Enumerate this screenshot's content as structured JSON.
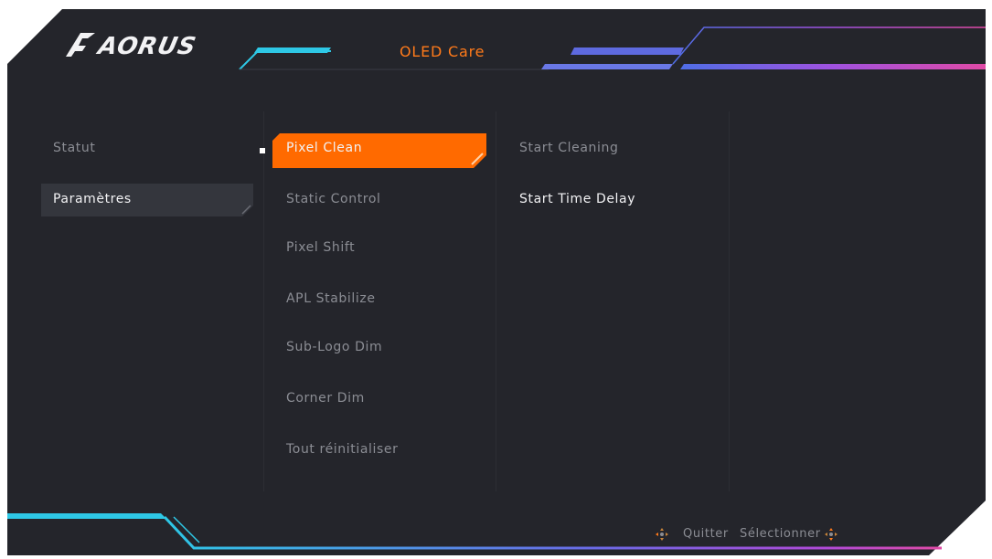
{
  "header": {
    "brand": "AORUS",
    "title": "OLED Care"
  },
  "left_menu": {
    "items": [
      {
        "label": "Statut",
        "selected": false
      },
      {
        "label": "Paramètres",
        "selected": true
      }
    ]
  },
  "middle_menu": {
    "items": [
      {
        "label": "Pixel Clean",
        "selected": true
      },
      {
        "label": "Static Control",
        "selected": false
      },
      {
        "label": "Pixel Shift",
        "selected": false
      },
      {
        "label": "APL Stabilize",
        "selected": false
      },
      {
        "label": "Sub-Logo Dim",
        "selected": false
      },
      {
        "label": "Corner Dim",
        "selected": false
      },
      {
        "label": "Tout réinitialiser",
        "selected": false
      }
    ]
  },
  "right_menu": {
    "items": [
      {
        "label": "Start Cleaning",
        "enabled": false
      },
      {
        "label": "Start Time Delay",
        "enabled": true
      }
    ]
  },
  "footer": {
    "quit_label": "Quitter",
    "select_label": "Sélectionner",
    "quit_icon": "joystick-move-icon",
    "select_icon": "joystick-press-icon"
  },
  "colors": {
    "background": "#24252b",
    "accent_orange": "#ff6a00",
    "accent_cyan": "#2ec8e6",
    "accent_purple": "#a052e0",
    "accent_pink": "#e04aa6"
  }
}
